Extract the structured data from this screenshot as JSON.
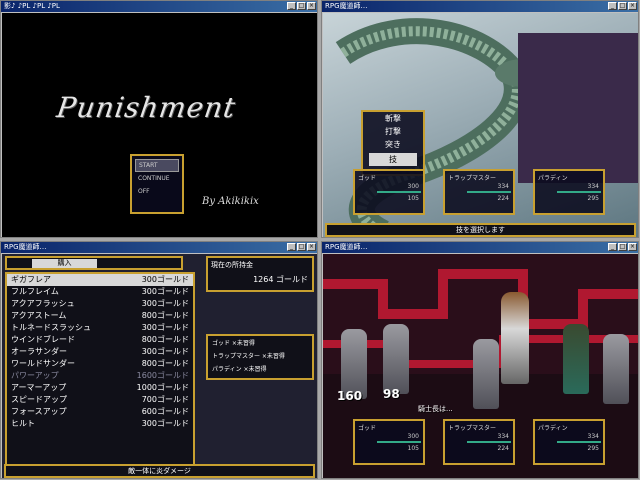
{
  "windows": [
    {
      "title": "影♪ ♪PL ♪PL ♪PL",
      "tb_btns": [
        "_",
        "□",
        "×"
      ]
    },
    {
      "title": "RPG魔道師…",
      "tb_btns": [
        "_",
        "□",
        "×"
      ]
    },
    {
      "title": "RPG魔道師…",
      "tb_btns": [
        "_",
        "□",
        "×"
      ]
    },
    {
      "title": "RPG魔道師…",
      "tb_btns": [
        "_",
        "□",
        "×"
      ]
    }
  ],
  "title_screen": {
    "logo": "Punishment",
    "byline": "By Akikikix",
    "menu": [
      "START",
      "CONTINUE",
      "OFF"
    ]
  },
  "dragon_battle": {
    "commands": [
      "斬撃",
      "打撃",
      "突き",
      "技"
    ],
    "selected_command": "技",
    "party": [
      {
        "name": "ゴッド",
        "hp": "300",
        "sp": "105"
      },
      {
        "name": "トラップマスター",
        "hp": "334",
        "sp": "224"
      },
      {
        "name": "パラディン",
        "hp": "334",
        "sp": "295"
      }
    ],
    "message": "技を選択します"
  },
  "shop": {
    "header_button": "購入",
    "items": [
      {
        "name": "ギガフレア",
        "price": "300ゴールド"
      },
      {
        "name": "フルフレイム",
        "price": "300ゴールド"
      },
      {
        "name": "アクアフラッシュ",
        "price": "300ゴールド"
      },
      {
        "name": "アクアストーム",
        "price": "800ゴールド"
      },
      {
        "name": "トルネードスラッシュ",
        "price": "300ゴールド"
      },
      {
        "name": "ウインドブレード",
        "price": "800ゴールド"
      },
      {
        "name": "オーラサンダー",
        "price": "300ゴールド"
      },
      {
        "name": "ワールドサンダー",
        "price": "800ゴールド"
      },
      {
        "name": "パワーアップ",
        "price": "1600ゴールド"
      },
      {
        "name": "アーマーアップ",
        "price": "1000ゴールド"
      },
      {
        "name": "スピードアップ",
        "price": "700ゴールド"
      },
      {
        "name": "フォースアップ",
        "price": "600ゴールド"
      },
      {
        "name": "ヒルト",
        "price": "300ゴールド"
      }
    ],
    "money_label": "現在の所持金",
    "money_value": "1264 ゴールド",
    "class_check": [
      "ゴッド ×未習得",
      "トラップマスター ×未習得",
      "パラディン ×未習得"
    ],
    "description": "敵一体に炎ダメージ"
  },
  "knight_battle": {
    "damage": [
      "160",
      "98"
    ],
    "message": "騎士長は...",
    "party": [
      {
        "name": "ゴッド",
        "hp": "300",
        "sp": "105"
      },
      {
        "name": "トラップマスター",
        "hp": "334",
        "sp": "224"
      },
      {
        "name": "パラディン",
        "hp": "334",
        "sp": "295"
      }
    ]
  }
}
